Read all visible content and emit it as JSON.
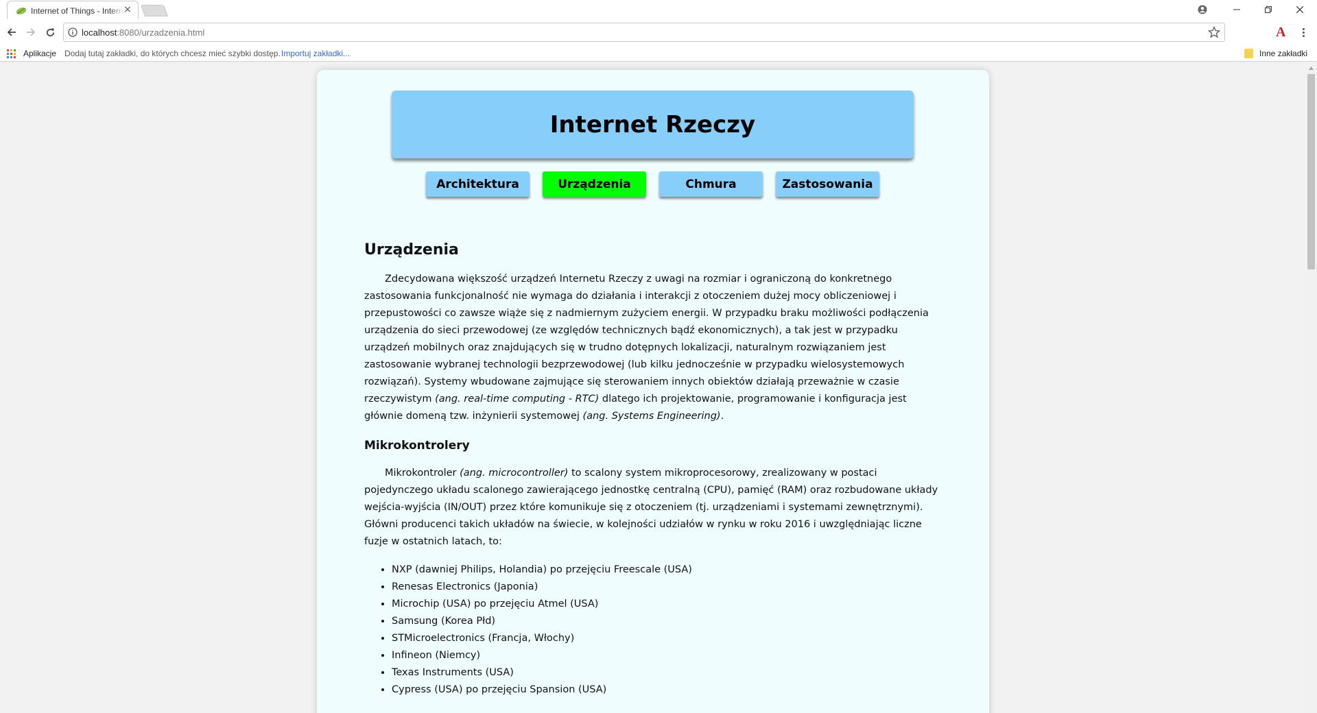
{
  "browser": {
    "tab_title": "Internet of Things - Internet Rzeczy",
    "url_host": "localhost",
    "url_path": ":8080/urzadzenia.html",
    "bookmarks_bar": {
      "apps_label": "Aplikacje",
      "hint": "Dodaj tutaj zakładki, do których chcesz mieć szybki dostęp.",
      "import_link": "Importuj zakładki...",
      "other_bookmarks": "Inne zakładki"
    }
  },
  "page": {
    "header_title": "Internet Rzeczy",
    "nav": [
      {
        "label": "Architektura",
        "active": false
      },
      {
        "label": "Urządzenia",
        "active": true
      },
      {
        "label": "Chmura",
        "active": false
      },
      {
        "label": "Zastosowania",
        "active": false
      }
    ],
    "section_title": "Urządzenia",
    "intro": {
      "part1": "Zdecydowana większość urządzeń Internetu Rzeczy z uwagi na rozmiar i ograniczoną do konkretnego zastosowania funkcjonalność nie wymaga do działania i interakcji z otoczeniem dużej mocy obliczeniowej i przepustowości co zawsze wiąże się z nadmiernym zużyciem energii. W przypadku braku możliwości podłączenia urządzenia do sieci przewodowej (ze względów technicznych bądź ekonomicznych), a tak jest w przypadku urządzeń mobilnych oraz znajdujących się w trudno dotępnych lokalizacji, naturalnym rozwiązaniem jest zastosowanie wybranej technologii bezprzewodowej (lub kilku jednocześnie w przypadku wielosystemowych rozwiązań). Systemy wbudowane zajmujące się sterowaniem innych obiektów działają przeważnie w czasie rzeczywistym",
      "em1": "(ang. real-time computing - RTC)",
      "part2": " dlatego ich projektowanie, programowanie i konfiguracja jest głównie domeną tzw. inżynierii systemowej",
      "em2": "(ang. Systems Engineering)",
      "part3": "."
    },
    "subsection_title": "Mikrokontrolery",
    "micro": {
      "part1": "Mikrokontroler",
      "em1": "(ang. microcontroller)",
      "part2": " to scalony system mikroprocesorowy, zrealizowany w postaci pojedynczego układu scalonego zawierającego jednostkę centralną (CPU), pamięć (RAM) oraz rozbudowane układy wejścia-wyjścia (IN/OUT) przez które komunikuje się z otoczeniem (tj. urządzeniami i systemami zewnętrznymi). Główni producenci takich układów na świecie, w kolejności udziałów w rynku w roku 2016 i uwzględniając liczne fuzje w ostatnich latach, to:"
    },
    "manufacturers": [
      "NXP (dawniej Philips, Holandia) po przejęciu Freescale (USA)",
      "Renesas Electronics (Japonia)",
      "Microchip (USA) po przejęciu Atmel (USA)",
      "Samsung (Korea Płd)",
      "STMicroelectronics (Francja, Włochy)",
      "Infineon (Niemcy)",
      "Texas Instruments (USA)",
      "Cypress (USA) po przejęciu Spansion (USA)"
    ]
  },
  "colors": {
    "header_bg": "#87cefa",
    "nav_active_bg": "#00ff00",
    "container_bg": "#f0fdff"
  }
}
